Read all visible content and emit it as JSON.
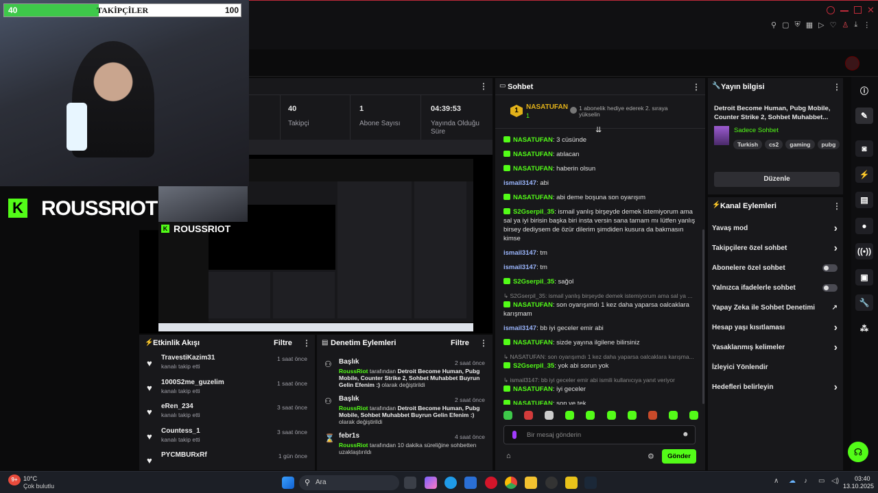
{
  "overlay": {
    "goal_current": "40",
    "goal_label": "TAKİPÇİLER",
    "goal_target": "100",
    "goal_progress": 0.4,
    "brand": "ROUSSRIOT",
    "brand_small": "ROUSSRIOT"
  },
  "stats": {
    "followers_value": "40",
    "followers_label": "Takipçi",
    "subs_value": "1",
    "subs_label": "Abone Sayısı",
    "uptime_value": "04:39:53",
    "uptime_label": "Yayında Olduğu Süre"
  },
  "chat": {
    "title": "Sohbet",
    "pinned_user": "NASATUFAN",
    "pinned_count": "1",
    "pinned_rank": "1",
    "pinned_text": "1 abonelik hediye ederek 2. sıraya yükselin",
    "messages": [
      {
        "user": "NASATUFAN",
        "text": ": 3 cüsünde",
        "badge": true,
        "style": "green"
      },
      {
        "user": "NASATUFAN",
        "text": ": atılacan",
        "badge": true,
        "style": "green"
      },
      {
        "user": "NASATUFAN",
        "text": ": haberin olsun",
        "badge": true,
        "style": "green"
      },
      {
        "user": "ismail3147",
        "text": ": abi",
        "badge": false,
        "style": "blue"
      },
      {
        "user": "NASATUFAN",
        "text": ": abi deme boşuna son oyarışım",
        "badge": true,
        "style": "green"
      },
      {
        "user": "S2Gserpil_35",
        "text": ": ismail yanlış birşeyde demek istemiyorum ama sal ya iyi birisin başka biri insta versin sana tamam mı lütfen yanlış birsey dediysem de özür dilerim şimdiden kusura da bakmasın kimse",
        "badge": true,
        "style": "green"
      },
      {
        "user": "ismail3147",
        "text": ": tm",
        "badge": false,
        "style": "blue"
      },
      {
        "user": "ismail3147",
        "text": ": tm",
        "badge": false,
        "style": "blue"
      },
      {
        "user": "S2Gserpil_35",
        "text": ": sağol",
        "badge": true,
        "style": "green"
      },
      {
        "reply": "S2Gserpil_35: ismail yanlış birşeyde demek istemiyorum ama sal ya ..."
      },
      {
        "user": "NASATUFAN",
        "text": ": son oyarışımdı 1 kez daha yaparsa oalcaklara karışmam",
        "badge": true,
        "style": "green"
      },
      {
        "user": "ismail3147",
        "text": ": bb iyi geceler emir abi",
        "badge": false,
        "style": "blue"
      },
      {
        "user": "NASATUFAN",
        "text": ": sizde yayına ilgilene bilirsiniz",
        "badge": true,
        "style": "green"
      },
      {
        "reply": "NASATUFAN: son oyarışımdı 1 kez daha yaparsa oalcaklara karışma..."
      },
      {
        "user": "S2Gserpil_35",
        "text": ": yok abi sorun yok",
        "badge": true,
        "style": "green"
      },
      {
        "reply": "ismail3147: bb iyi geceler emir abi ismili kullanıcıya yanıt veriyor"
      },
      {
        "user": "NASATUFAN",
        "text": ": iyi geceler",
        "badge": true,
        "style": "green"
      },
      {
        "user": "NASATUFAN",
        "text": ": son ve tek",
        "badge": true,
        "style": "green"
      }
    ],
    "input_placeholder": "Bir mesaj gönderin",
    "send_label": "Gönder"
  },
  "stream_info": {
    "title": "Yayın bilgisi",
    "stream_title": "Detroit Become Human, Pubg Mobile, Counter Strike 2, Sohbet Muhabbet...",
    "category": "Sadece Sohbet",
    "tags": [
      "Turkish",
      "cs2",
      "gaming",
      "pubg"
    ],
    "edit_label": "Düzenle"
  },
  "channel_actions": {
    "title": "Kanal Eylemleri",
    "items": [
      {
        "label": "Yavaş mod",
        "control": "chevron"
      },
      {
        "label": "Takipçilere özel sohbet",
        "control": "chevron"
      },
      {
        "label": "Abonelere özel sohbet",
        "control": "toggle"
      },
      {
        "label": "Yalnızca ifadelerle sohbet",
        "control": "toggle"
      },
      {
        "label": "Yapay Zeka ile Sohbet Denetimi",
        "control": "external"
      },
      {
        "label": "Hesap yaşı kısıtlaması",
        "control": "chevron"
      },
      {
        "label": "Yasaklanmış kelimeler",
        "control": "chevron"
      },
      {
        "label": "İzleyici Yönlendir",
        "control": "none"
      },
      {
        "label": "Hedefleri belirleyin",
        "control": "chevron"
      }
    ]
  },
  "activity": {
    "title": "Etkinlik Akışı",
    "filter": "Filtre",
    "items": [
      {
        "name": "TravestiKazim31",
        "sub": "kanalı takip etti",
        "time": "1 saat önce"
      },
      {
        "name": "1000S2me_guzelim",
        "sub": "kanalı takip etti",
        "time": "1 saat önce"
      },
      {
        "name": "eRen_234",
        "sub": "kanalı takip etti",
        "time": "3 saat önce"
      },
      {
        "name": "Countess_1",
        "sub": "kanalı takip etti",
        "time": "3 saat önce"
      },
      {
        "name": "PYCMBURxRf",
        "sub": "",
        "time": "1 gün önce"
      }
    ]
  },
  "moderation": {
    "title": "Denetim Eylemleri",
    "filter": "Filtre",
    "items": [
      {
        "name": "Başlık",
        "time": "2 saat önce",
        "actor": "RoussRiot",
        "mid": " tarafından ",
        "bold": "Detroit Become Human, Pubg Mobile, Counter Strike 2, Sohbet Muhabbet Buyrun Gelin Efenim :)",
        "tail": " olarak değiştirildi"
      },
      {
        "name": "Başlık",
        "time": "2 saat önce",
        "actor": "RoussRiot",
        "mid": " tarafından ",
        "bold": "Detroit Become Human, Pubg Mobile, Sohbet Muhabbet Buyrun Gelin Efenim :)",
        "tail": " olarak değiştirildi"
      },
      {
        "name": "febr1s",
        "time": "4 saat önce",
        "actor": "RoussRiot",
        "mid": " tarafından 10 dakika süreliğine sohbetten uzaklaştırıldı",
        "bold": "",
        "tail": ""
      }
    ]
  },
  "taskbar": {
    "weather_temp": "10°C",
    "weather_desc": "Çok bulutlu",
    "weather_badge": "9+",
    "search_placeholder": "Ara",
    "time": "03:40",
    "date": "13.10.2025"
  },
  "colors": {
    "accent": "#53fc18",
    "panel": "#18181b",
    "bg": "#0b0b0c"
  }
}
